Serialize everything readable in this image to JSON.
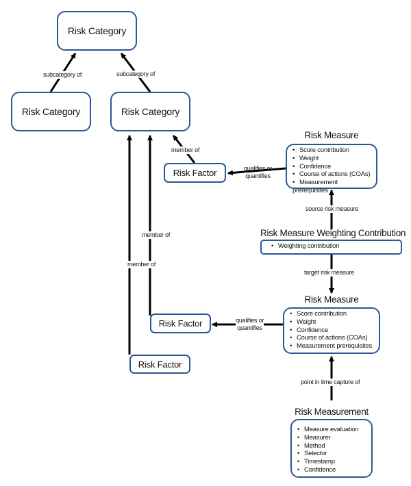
{
  "nodes": {
    "category_top": "Risk Category",
    "category_left": "Risk Category",
    "category_mid": "Risk Category",
    "factor_1": "Risk Factor",
    "factor_2": "Risk Factor",
    "factor_3": "Risk Factor"
  },
  "risk_measure_top": {
    "title": "Risk Measure",
    "items": [
      "Score contribution",
      "Weight",
      "Confidence",
      "Course of actions (COAs)",
      "Measurement prerequisites"
    ]
  },
  "weighting": {
    "title": "Risk Measure Weighting Contribution",
    "items": [
      "Weighting contribution"
    ]
  },
  "risk_measure_bottom": {
    "title": "Risk Measure",
    "items": [
      "Score contribution",
      "Weight",
      "Confidence",
      "Course of actions (COAs)",
      "Measurement prerequisites"
    ]
  },
  "measurement": {
    "title": "Risk Measurement",
    "items": [
      "Measure evaluation",
      "Measurer",
      "Method",
      "Selector",
      "Timestamp",
      "Confidence"
    ]
  },
  "edges": {
    "subcategory_left": "subcategory of",
    "subcategory_right": "subcategory of",
    "member_of_1": "member of",
    "member_of_2": "member of",
    "member_of_3": "member of",
    "qualifies_top_1": "qualifies or",
    "qualifies_top_2": "quantifies",
    "qualifies_bottom_1": "qualifies or",
    "qualifies_bottom_2": "quantifies",
    "source_risk_measure": "source risk measure",
    "target_risk_measure": "target risk measure",
    "point_in_time": "point in time capture of"
  }
}
